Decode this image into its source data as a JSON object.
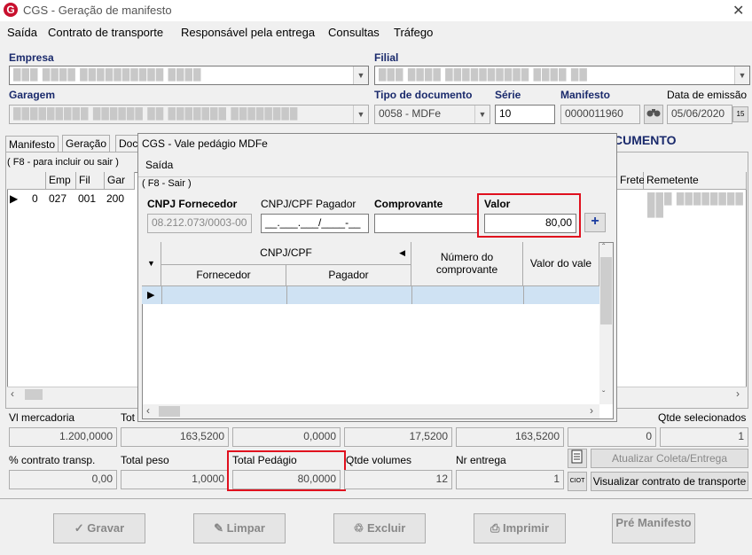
{
  "window": {
    "title": "CGS - Geração de manifesto",
    "close_glyph": "✕"
  },
  "menu": [
    "Saída",
    "Contrato de transporte",
    "Responsável pela entrega",
    "Consultas",
    "Tráfego"
  ],
  "form": {
    "empresa_label": "Empresa",
    "filial_label": "Filial",
    "garagem_label": "Garagem",
    "tipo_doc_label": "Tipo de documento",
    "tipo_doc_value": "0058 - MDFe",
    "serie_label": "Série",
    "serie_value": "10",
    "manifesto_label": "Manifesto",
    "manifesto_value": "0000011960",
    "data_emissao_label": "Data de emissão",
    "data_emissao_value": "05/06/2020",
    "calendar_glyph": "15"
  },
  "tabs": [
    "Manifesto",
    "Geração",
    "Doc"
  ],
  "hint_main": "( F8 - para incluir ou sair )",
  "doc_banner": "CUMENTO",
  "main_grid": {
    "columns": [
      "Emp",
      "Fil",
      "Gar"
    ],
    "row": {
      "num": "0",
      "emp": "027",
      "fil": "001",
      "gar": "200"
    },
    "right_columns": [
      "Frete",
      "Remetente"
    ]
  },
  "totals_row1": {
    "labels": [
      "Vl mercadoria",
      "Tot",
      "Qtde selecionados"
    ],
    "values": [
      "1.200,0000",
      "163,5200",
      "0,0000",
      "17,5200",
      "163,5200",
      "0",
      "1"
    ]
  },
  "totals_row2": {
    "labels": [
      "% contrato transp.",
      "Total peso",
      "Total Pedágio",
      "Qtde volumes",
      "Nr entrega"
    ],
    "values": [
      "0,00",
      "1,0000",
      "80,0000",
      "12",
      "1"
    ]
  },
  "side_buttons": {
    "atualizar": "Atualizar Coleta/Entrega",
    "visualizar": "Visualizar contrato de transporte",
    "ciot_glyph": "CIOT"
  },
  "bottom_buttons": [
    "Gravar",
    "Limpar",
    "Excluir",
    "Imprimir",
    "Pré Manifesto"
  ],
  "dialog": {
    "title": "CGS - Vale pedágio MDFe",
    "menu": "Saída",
    "hint": "( F8 - Sair )",
    "cnpj_fornecedor_label": "CNPJ Fornecedor",
    "cnpj_fornecedor_value": "08.212.073/0003-00",
    "cnpj_pagador_label": "CNPJ/CPF Pagador",
    "cnpj_pagador_placeholder": "__.___.___/____-__",
    "comprovante_label": "Comprovante",
    "valor_label": "Valor",
    "valor_value": "80,00",
    "add_glyph": "+",
    "grid": {
      "group": "CNPJ/CPF",
      "sub": [
        "Fornecedor",
        "Pagador"
      ],
      "numero": "Número do comprovante",
      "valor": "Valor do vale"
    }
  },
  "colors": {
    "accent_red": "#e0101e",
    "label_blue": "#1a2a6c"
  }
}
